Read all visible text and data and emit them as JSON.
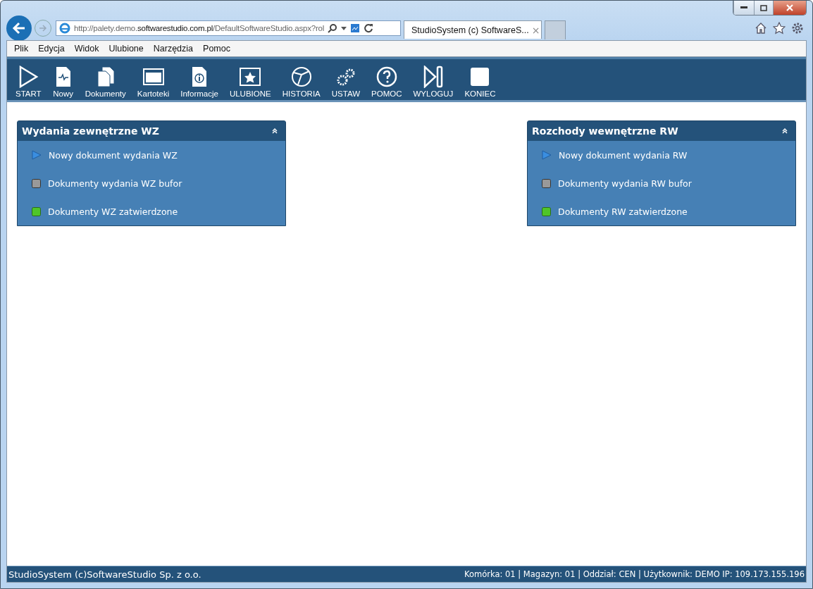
{
  "browser": {
    "address": "http://palety.demo.**softwarestudio.com.pl**/DefaultSoftwareStudio.aspx?rol",
    "tab_title": "StudioSystem (c) SoftwareS...",
    "tab_close": "×"
  },
  "menu": [
    "Plik",
    "Edycja",
    "Widok",
    "Ulubione",
    "Narzędzia",
    "Pomoc"
  ],
  "toolbar": [
    {
      "label": "START",
      "kind": "play"
    },
    {
      "label": "Nowy",
      "kind": "new"
    },
    {
      "label": "Dokumenty",
      "kind": "docs"
    },
    {
      "label": "Kartoteki",
      "kind": "window"
    },
    {
      "label": "Informacje",
      "kind": "info"
    },
    {
      "label": "ULUBIONE",
      "kind": "star"
    },
    {
      "label": "HISTORIA",
      "kind": "history"
    },
    {
      "label": "USTAW",
      "kind": "gears"
    },
    {
      "label": "POMOC",
      "kind": "help"
    },
    {
      "label": "WYLOGUJ",
      "kind": "logout"
    },
    {
      "label": "KONIEC",
      "kind": "stop"
    }
  ],
  "panels": [
    {
      "title": "Wydania zewnętrzne WZ",
      "expanded": true,
      "items": [
        {
          "label": "Nowy dokument wydania WZ",
          "kind": "arrow"
        },
        {
          "label": "Dokumenty wydania WZ bufor",
          "kind": "grey"
        },
        {
          "label": "Dokumenty WZ zatwierdzone",
          "kind": "green"
        }
      ]
    },
    {
      "title": "Rozchody wewnętrzne RW",
      "expanded": true,
      "items": [
        {
          "label": "Nowy dokument wydania RW",
          "kind": "arrow"
        },
        {
          "label": "Dokumenty wydania RW bufor",
          "kind": "grey"
        },
        {
          "label": "Dokumenty RW zatwierdzone",
          "kind": "green"
        }
      ]
    }
  ],
  "status_bar": {
    "left": "StudioSystem (c)SoftwareStudio Sp. z o.o.",
    "right": "Komórka: 01 | Magazyn: 01 | Oddział: CEN | Użytkownik: DEMO IP: 109.173.155.196"
  }
}
